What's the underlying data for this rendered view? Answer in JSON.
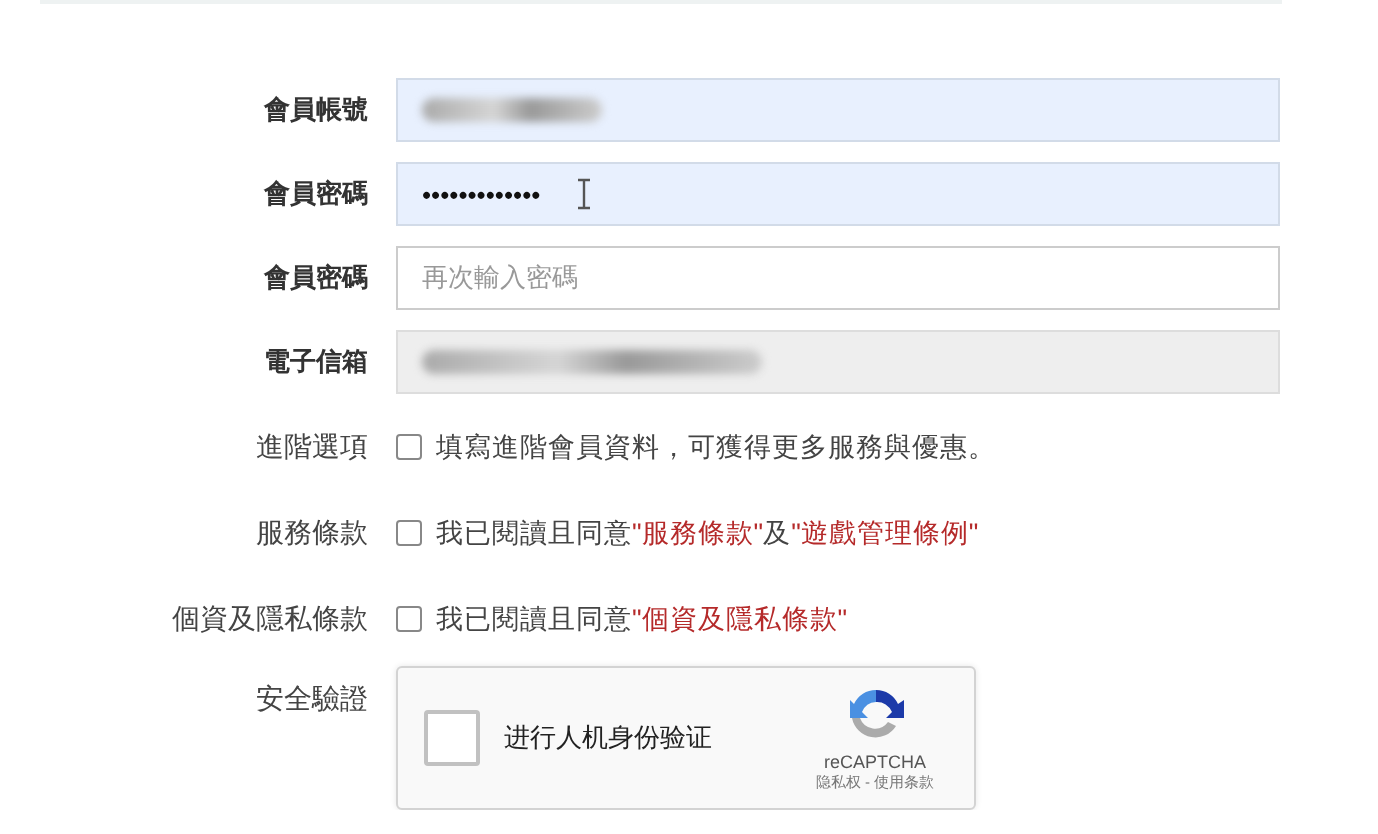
{
  "fields": [
    {
      "label": "會員帳號",
      "kind": "blurred",
      "autofilled": true,
      "disabled": false
    },
    {
      "label": "會員密碼",
      "kind": "password",
      "value": "•••••••••••••",
      "autofilled": true,
      "disabled": false,
      "cursor": true
    },
    {
      "label": "會員密碼",
      "kind": "empty",
      "placeholder": "再次輸入密碼",
      "autofilled": false,
      "disabled": false
    },
    {
      "label": "電子信箱",
      "kind": "blurred",
      "autofilled": false,
      "disabled": true
    }
  ],
  "options": [
    {
      "label": "進階選項",
      "checked": false,
      "parts": [
        {
          "kind": "text",
          "text": "填寫進階會員資料，可獲得更多服務與優惠。"
        }
      ]
    },
    {
      "label": "服務條款",
      "checked": false,
      "parts": [
        {
          "kind": "text",
          "text": "我已閱讀且同意"
        },
        {
          "kind": "link",
          "text": "\"服務條款\""
        },
        {
          "kind": "text",
          "text": "及"
        },
        {
          "kind": "link",
          "text": "\"遊戲管理條例\""
        }
      ]
    },
    {
      "label": "個資及隱私條款",
      "checked": false,
      "parts": [
        {
          "kind": "text",
          "text": "我已閱讀且同意"
        },
        {
          "kind": "link",
          "text": "\"個資及隱私條款\""
        }
      ]
    }
  ],
  "captcha": {
    "label": "安全驗證",
    "checked": false,
    "text": "进行人机身份验证",
    "brand": "reCAPTCHA",
    "links": "隐私权 - 使用条款"
  }
}
